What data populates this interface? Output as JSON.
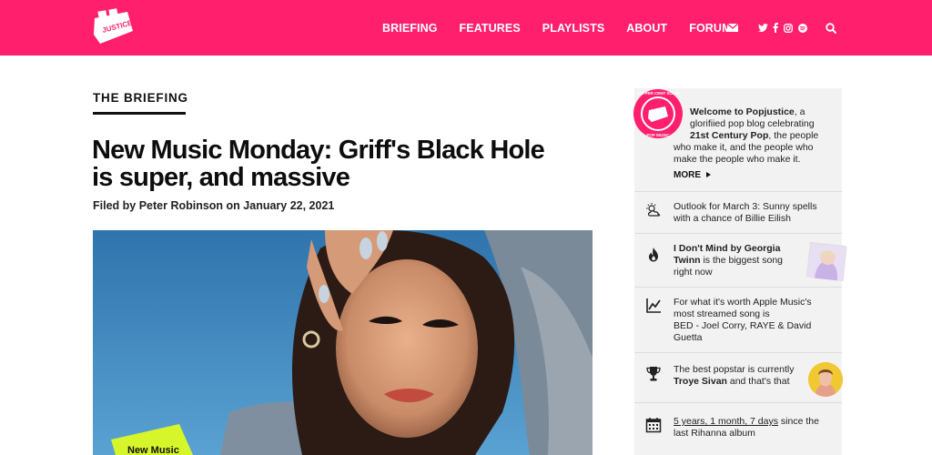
{
  "header": {
    "logo_name": "popjustice-logo",
    "nav": [
      "BRIEFING",
      "FEATURES",
      "PLAYLISTS",
      "ABOUT",
      "FORUM"
    ],
    "icons": [
      "mail-icon",
      "twitter-icon",
      "facebook-icon",
      "instagram-icon",
      "spotify-icon",
      "search-icon"
    ],
    "brand_color": "#ff1f6d"
  },
  "article": {
    "section": "THE BRIEFING",
    "title_line1": "New Music Monday: Griff's Black Hole",
    "title_line2": "is super, and massive",
    "byline": "Filed by Peter Robinson on January 22, 2021",
    "badge_text": "New Music"
  },
  "sidebar": {
    "welcome": {
      "line1_bold": "Welcome to Popjustice",
      "line1_rest": ", a",
      "line2": "glorifiied pop blog celebrating",
      "line3_bold": "21st Century Pop",
      "line3_rest": ", the people",
      "line4": "who make it, and the people who",
      "line5": "make the people who make it.",
      "more": "MORE",
      "seal_top": "100 PER CENT SOLID",
      "seal_bottom": "POP MUSIC"
    },
    "outlook": {
      "line1": "Outlook for March 3: Sunny spells",
      "line2": "with a chance of Billie Eilish"
    },
    "song": {
      "line1_bold": "I Don't Mind by Georgia",
      "line2_bold": "Twinn",
      "line2_rest": " is the biggest song",
      "line3": "right now"
    },
    "streamed": {
      "line1": "For what it's worth Apple Music's",
      "line2": "most streamed song is",
      "line3": "BED - Joel Corry, RAYE & David",
      "line4": "Guetta"
    },
    "popstar": {
      "line1": "The best popstar is currently",
      "line2_bold": "Troye Sivan",
      "line2_rest": " and that's that"
    },
    "countdown": {
      "line1_link": "5 years, 1 month, 7 days",
      "line1_rest": " since the",
      "line2": "last Rihanna album"
    }
  }
}
